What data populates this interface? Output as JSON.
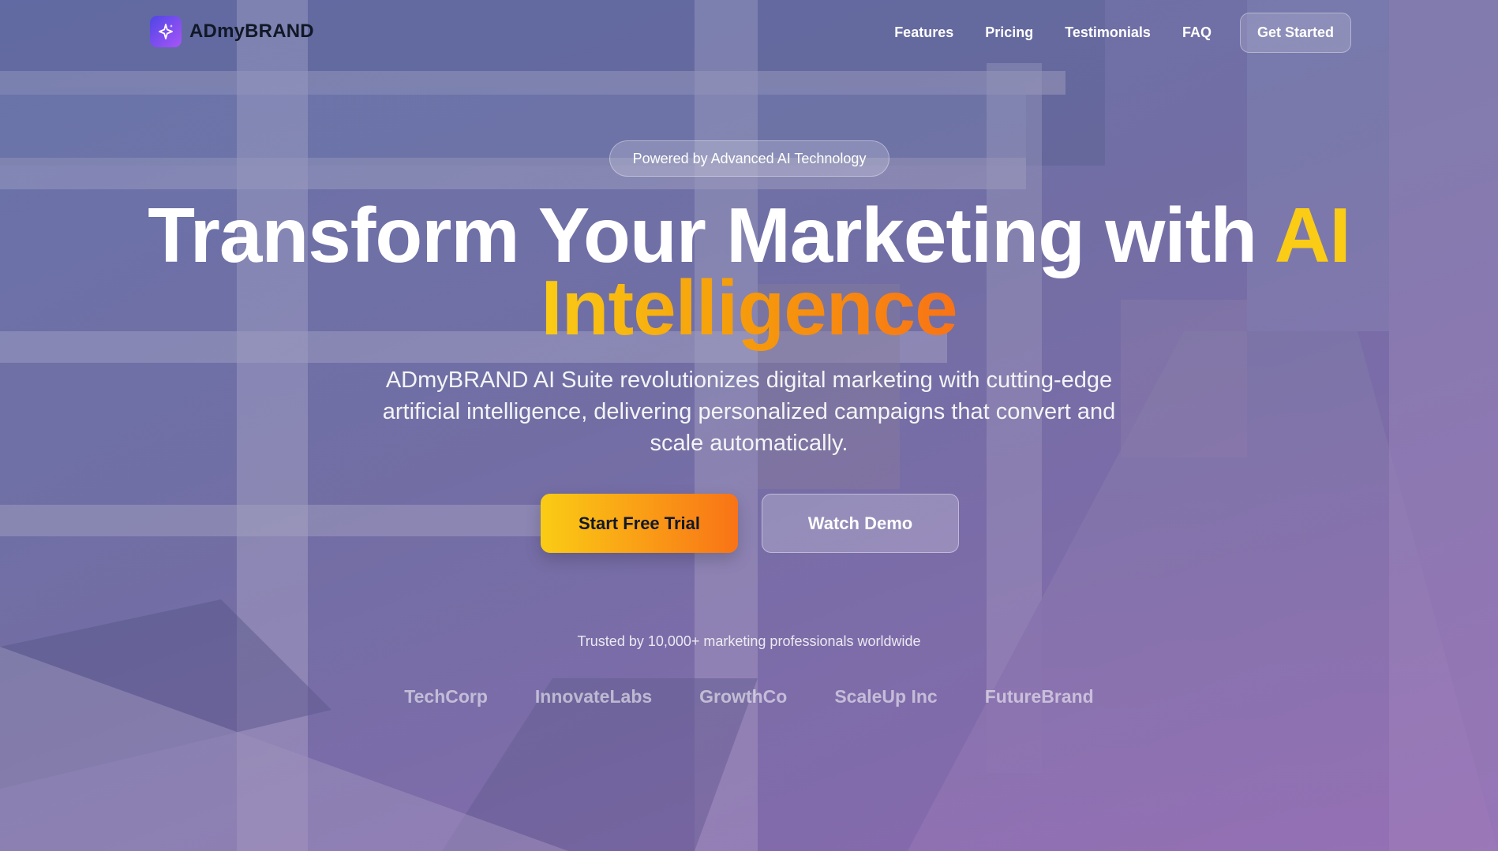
{
  "brand": {
    "name": "ADmyBRAND",
    "icon": "sparkle-icon"
  },
  "nav": {
    "links": [
      "Features",
      "Pricing",
      "Testimonials",
      "FAQ"
    ],
    "cta": "Get Started"
  },
  "hero": {
    "badge": "Powered by Advanced AI Technology",
    "headline_main": "Transform Your Marketing with ",
    "headline_ai": "AI",
    "headline_accent": "Intelligence",
    "subtitle": "ADmyBRAND AI Suite revolutionizes digital marketing with cutting-edge artificial intelligence, delivering personalized campaigns that convert and scale automatically.",
    "primary_button": "Start Free Trial",
    "secondary_button": "Watch Demo"
  },
  "social_proof": {
    "text": "Trusted by 10,000+ marketing professionals worldwide",
    "logos": [
      "TechCorp",
      "InnovateLabs",
      "GrowthCo",
      "ScaleUp Inc",
      "FutureBrand"
    ]
  },
  "colors": {
    "accent_yellow": "#facc15",
    "accent_orange": "#f97316",
    "logo_gradient_start": "#4f46e5",
    "logo_gradient_end": "#a855f7",
    "overlay": "#5a5f8e"
  }
}
